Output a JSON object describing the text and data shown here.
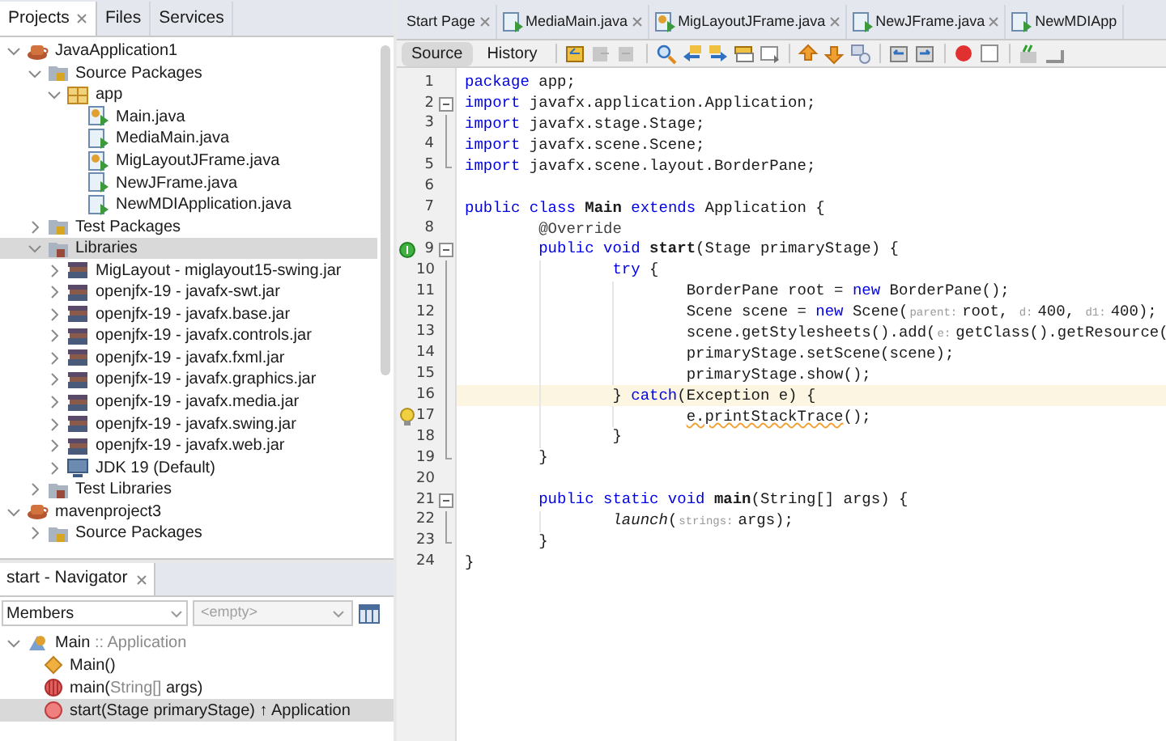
{
  "projects_panel": {
    "tabs": [
      {
        "label": "Projects",
        "selected": true,
        "closable": true
      },
      {
        "label": "Files",
        "selected": false,
        "closable": false
      },
      {
        "label": "Services",
        "selected": false,
        "closable": false
      }
    ],
    "tree": [
      {
        "label": "JavaApplication1",
        "kind": "project",
        "expanded": true,
        "selected": false,
        "children": [
          {
            "label": "Source Packages",
            "kind": "folder",
            "expanded": true,
            "selected": false,
            "children": [
              {
                "label": "app",
                "kind": "package",
                "expanded": true,
                "selected": false,
                "children": [
                  {
                    "label": "Main.java",
                    "kind": "main-file",
                    "selected": false
                  },
                  {
                    "label": "MediaMain.java",
                    "kind": "file",
                    "selected": false
                  },
                  {
                    "label": "MigLayoutJFrame.java",
                    "kind": "main-file",
                    "selected": false
                  },
                  {
                    "label": "NewJFrame.java",
                    "kind": "file",
                    "selected": false
                  },
                  {
                    "label": "NewMDIApplication.java",
                    "kind": "file",
                    "selected": false
                  }
                ]
              }
            ]
          },
          {
            "label": "Test Packages",
            "kind": "folder",
            "expanded": false,
            "selected": false
          },
          {
            "label": "Libraries",
            "kind": "library",
            "expanded": true,
            "selected": true,
            "children": [
              {
                "label": "MigLayout - miglayout15-swing.jar",
                "kind": "jar",
                "expanded": false,
                "selected": false
              },
              {
                "label": "openjfx-19 - javafx-swt.jar",
                "kind": "jar",
                "expanded": false,
                "selected": false
              },
              {
                "label": "openjfx-19 - javafx.base.jar",
                "kind": "jar",
                "expanded": false,
                "selected": false
              },
              {
                "label": "openjfx-19 - javafx.controls.jar",
                "kind": "jar",
                "expanded": false,
                "selected": false
              },
              {
                "label": "openjfx-19 - javafx.fxml.jar",
                "kind": "jar",
                "expanded": false,
                "selected": false
              },
              {
                "label": "openjfx-19 - javafx.graphics.jar",
                "kind": "jar",
                "expanded": false,
                "selected": false
              },
              {
                "label": "openjfx-19 - javafx.media.jar",
                "kind": "jar",
                "expanded": false,
                "selected": false
              },
              {
                "label": "openjfx-19 - javafx.swing.jar",
                "kind": "jar",
                "expanded": false,
                "selected": false
              },
              {
                "label": "openjfx-19 - javafx.web.jar",
                "kind": "jar",
                "expanded": false,
                "selected": false
              },
              {
                "label": "JDK 19 (Default)",
                "kind": "jdk",
                "expanded": false,
                "selected": false
              }
            ]
          },
          {
            "label": "Test Libraries",
            "kind": "library",
            "expanded": false,
            "selected": false
          }
        ]
      },
      {
        "label": "mavenproject3",
        "kind": "project",
        "expanded": true,
        "selected": false,
        "children": [
          {
            "label": "Source Packages",
            "kind": "folder",
            "expanded": false,
            "selected": false
          }
        ]
      }
    ]
  },
  "navigator": {
    "tab": {
      "label": "start - Navigator",
      "selected": true
    },
    "filter": {
      "value": "Members"
    },
    "second_filter": {
      "value": "<empty>",
      "disabled": true
    },
    "root": {
      "parts": [
        {
          "text": "Main",
          "dim": false
        },
        {
          "text": " :: Application",
          "dim": true
        }
      ],
      "expanded": true,
      "kind": "class"
    },
    "members": [
      {
        "kind": "constructor",
        "selected": false,
        "parts": [
          {
            "text": "Main()",
            "dim": false
          }
        ]
      },
      {
        "kind": "static-method",
        "selected": false,
        "parts": [
          {
            "text": "main(",
            "dim": false
          },
          {
            "text": "String[]",
            "dim": true
          },
          {
            "text": " args)",
            "dim": false
          }
        ]
      },
      {
        "kind": "method",
        "selected": true,
        "parts": [
          {
            "text": "start(Stage primaryStage) ↑ Application",
            "dim": false
          }
        ]
      }
    ]
  },
  "editor": {
    "tabs": [
      {
        "label": "Start Page",
        "kind": "page"
      },
      {
        "label": "MediaMain.java",
        "kind": "file"
      },
      {
        "label": "MigLayoutJFrame.java",
        "kind": "main-file"
      },
      {
        "label": "NewJFrame.java",
        "kind": "file"
      },
      {
        "label": "NewMDIApp",
        "kind": "file-cut"
      }
    ],
    "views": [
      {
        "label": "Source",
        "selected": true
      },
      {
        "label": "History",
        "selected": false
      }
    ],
    "lines": [
      {
        "number": "1",
        "fold_box": false,
        "fold_guide": false,
        "fold_end": false,
        "current": false,
        "tokens": [
          {
            "kind": "kw",
            "text": "package"
          },
          {
            "kind": "plain",
            "text": " app;"
          }
        ]
      },
      {
        "number": "2",
        "fold_box": true,
        "fold_guide": false,
        "fold_end": false,
        "current": false,
        "tokens": [
          {
            "kind": "kw",
            "text": "import"
          },
          {
            "kind": "plain",
            "text": " javafx.application.Application;"
          }
        ]
      },
      {
        "number": "3",
        "fold_box": false,
        "fold_guide": true,
        "fold_end": false,
        "current": false,
        "tokens": [
          {
            "kind": "kw",
            "text": "import"
          },
          {
            "kind": "plain",
            "text": " javafx.stage.Stage;"
          }
        ]
      },
      {
        "number": "4",
        "fold_box": false,
        "fold_guide": true,
        "fold_end": false,
        "current": false,
        "tokens": [
          {
            "kind": "kw",
            "text": "import"
          },
          {
            "kind": "plain",
            "text": " javafx.scene.Scene;"
          }
        ]
      },
      {
        "number": "5",
        "fold_box": false,
        "fold_guide": false,
        "fold_end": true,
        "current": false,
        "tokens": [
          {
            "kind": "kw",
            "text": "import"
          },
          {
            "kind": "plain",
            "text": " javafx.scene.layout.BorderPane;"
          }
        ]
      },
      {
        "number": "6",
        "fold_box": false,
        "fold_guide": false,
        "fold_end": false,
        "current": false
      },
      {
        "number": "7",
        "fold_box": false,
        "fold_guide": false,
        "fold_end": false,
        "current": false,
        "tokens": [
          {
            "kind": "kw",
            "text": "public class "
          },
          {
            "kind": "bold",
            "text": "Main"
          },
          {
            "kind": "kw",
            "text": " extends"
          },
          {
            "kind": "plain",
            "text": " Application {"
          }
        ]
      },
      {
        "number": "8",
        "fold_box": false,
        "fold_guide": false,
        "fold_end": false,
        "current": false,
        "tokens": [
          {
            "kind": "annotation",
            "text": "        @Override"
          }
        ]
      },
      {
        "number": "9",
        "fold_box": true,
        "fold_guide": false,
        "fold_end": false,
        "current": false,
        "gutter_icon": {
          "kind": "override"
        },
        "tokens": [
          {
            "kind": "kw",
            "text": "        public void "
          },
          {
            "kind": "bold",
            "text": "start"
          },
          {
            "kind": "plain",
            "text": "(Stage primaryStage) {"
          }
        ]
      },
      {
        "number": "10",
        "fold_box": false,
        "fold_guide": true,
        "fold_end": false,
        "current": false,
        "tokens": [
          {
            "kind": "kw",
            "text": "                try"
          },
          {
            "kind": "plain",
            "text": " {"
          }
        ]
      },
      {
        "number": "11",
        "fold_box": false,
        "fold_guide": true,
        "fold_end": false,
        "current": false,
        "tokens": [
          {
            "kind": "plain",
            "text": "                        BorderPane root = "
          },
          {
            "kind": "kw",
            "text": "new"
          },
          {
            "kind": "plain",
            "text": " BorderPane();"
          }
        ]
      },
      {
        "number": "12",
        "fold_box": false,
        "fold_guide": true,
        "fold_end": false,
        "current": false,
        "tokens": [
          {
            "kind": "plain",
            "text": "                        Scene scene = "
          },
          {
            "kind": "kw",
            "text": "new"
          },
          {
            "kind": "plain",
            "text": " Scene("
          },
          {
            "kind": "hint",
            "text": "parent:"
          },
          {
            "kind": "plain",
            "text": "root, "
          },
          {
            "kind": "hint",
            "text": "d:"
          },
          {
            "kind": "plain",
            "text": "400, "
          },
          {
            "kind": "hint",
            "text": "d1:"
          },
          {
            "kind": "plain",
            "text": "400);"
          }
        ]
      },
      {
        "number": "13",
        "fold_box": false,
        "fold_guide": true,
        "fold_end": false,
        "current": false,
        "tokens": [
          {
            "kind": "plain",
            "text": "                        scene.getStylesheets().add("
          },
          {
            "kind": "hint",
            "text": "e:"
          },
          {
            "kind": "plain",
            "text": "getClass().getResource("
          }
        ]
      },
      {
        "number": "14",
        "fold_box": false,
        "fold_guide": true,
        "fold_end": false,
        "current": false,
        "tokens": [
          {
            "kind": "plain",
            "text": "                        primaryStage.setScene(scene);"
          }
        ]
      },
      {
        "number": "15",
        "fold_box": false,
        "fold_guide": true,
        "fold_end": false,
        "current": false,
        "tokens": [
          {
            "kind": "plain",
            "text": "                        primaryStage.show();"
          }
        ]
      },
      {
        "number": "16",
        "fold_box": false,
        "fold_guide": true,
        "fold_end": false,
        "current": true,
        "tokens": [
          {
            "kind": "plain",
            "text": "                } "
          },
          {
            "kind": "kw",
            "text": "catch"
          },
          {
            "kind": "plain",
            "text": "(Exception e) {"
          }
        ]
      },
      {
        "number": "17",
        "fold_box": false,
        "fold_guide": true,
        "fold_end": false,
        "current": false,
        "gutter_icon": {
          "kind": "bulb"
        },
        "tokens": [
          {
            "kind": "warn",
            "text": "                        e.printStackTrace"
          },
          {
            "kind": "plain",
            "text": "();"
          }
        ]
      },
      {
        "number": "18",
        "fold_box": false,
        "fold_guide": true,
        "fold_end": false,
        "current": false,
        "tokens": [
          {
            "kind": "plain",
            "text": "                }"
          }
        ]
      },
      {
        "number": "19",
        "fold_box": false,
        "fold_guide": false,
        "fold_end": true,
        "current": false,
        "tokens": [
          {
            "kind": "plain",
            "text": "        }"
          }
        ]
      },
      {
        "number": "20",
        "fold_box": false,
        "fold_guide": false,
        "fold_end": false,
        "current": false
      },
      {
        "number": "21",
        "fold_box": true,
        "fold_guide": false,
        "fold_end": false,
        "current": false,
        "tokens": [
          {
            "kind": "kw",
            "text": "        public static void "
          },
          {
            "kind": "bold",
            "text": "main"
          },
          {
            "kind": "plain",
            "text": "(String[] args) {"
          }
        ]
      },
      {
        "number": "22",
        "fold_box": false,
        "fold_guide": true,
        "fold_end": false,
        "current": false,
        "tokens": [
          {
            "kind": "italic",
            "text": "                launch"
          },
          {
            "kind": "plain",
            "text": "("
          },
          {
            "kind": "hint",
            "text": "strings:"
          },
          {
            "kind": "plain",
            "text": "args);"
          }
        ]
      },
      {
        "number": "23",
        "fold_box": false,
        "fold_guide": false,
        "fold_end": true,
        "current": false,
        "tokens": [
          {
            "kind": "plain",
            "text": "        }"
          }
        ]
      },
      {
        "number": "24",
        "fold_box": false,
        "fold_guide": false,
        "fold_end": false,
        "current": false,
        "tokens": [
          {
            "kind": "plain",
            "text": "}"
          }
        ]
      }
    ]
  }
}
